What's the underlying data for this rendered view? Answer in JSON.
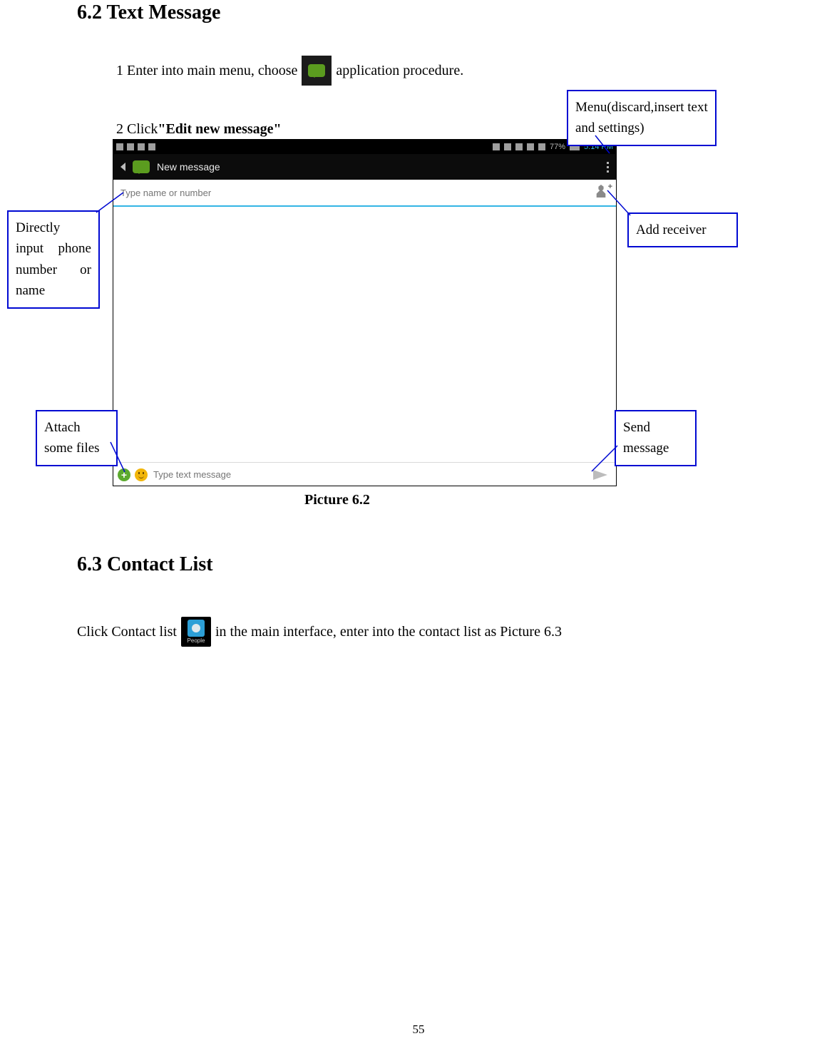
{
  "sections": {
    "s62": {
      "title": "6.2 Text Message"
    },
    "s63": {
      "title": "6.3 Contact List"
    }
  },
  "step1": {
    "prefix": "1 Enter into main menu, choose ",
    "suffix": "  application procedure."
  },
  "step2": {
    "prefix": "2 Click",
    "bold": "\"Edit new message\""
  },
  "step3": {
    "prefix": "Click Contact list ",
    "suffix": "  in the main interface, enter into the contact list as Picture 6.3"
  },
  "screenshot": {
    "statusbar": {
      "battery": "77%",
      "time": "5:14 PM"
    },
    "appbar": {
      "title": "New message"
    },
    "recipient": {
      "placeholder": "Type name or number"
    },
    "compose": {
      "placeholder": "Type text message"
    }
  },
  "callouts": {
    "menu": "Menu(discard,insert text and settings)",
    "directInput": "Directly input phone number or name",
    "addReceiver": "Add receiver",
    "attach": "Attach some files",
    "send": "Send message"
  },
  "peopleIconLabel": "People",
  "caption": "Picture 6.2",
  "pageNumber": "55"
}
